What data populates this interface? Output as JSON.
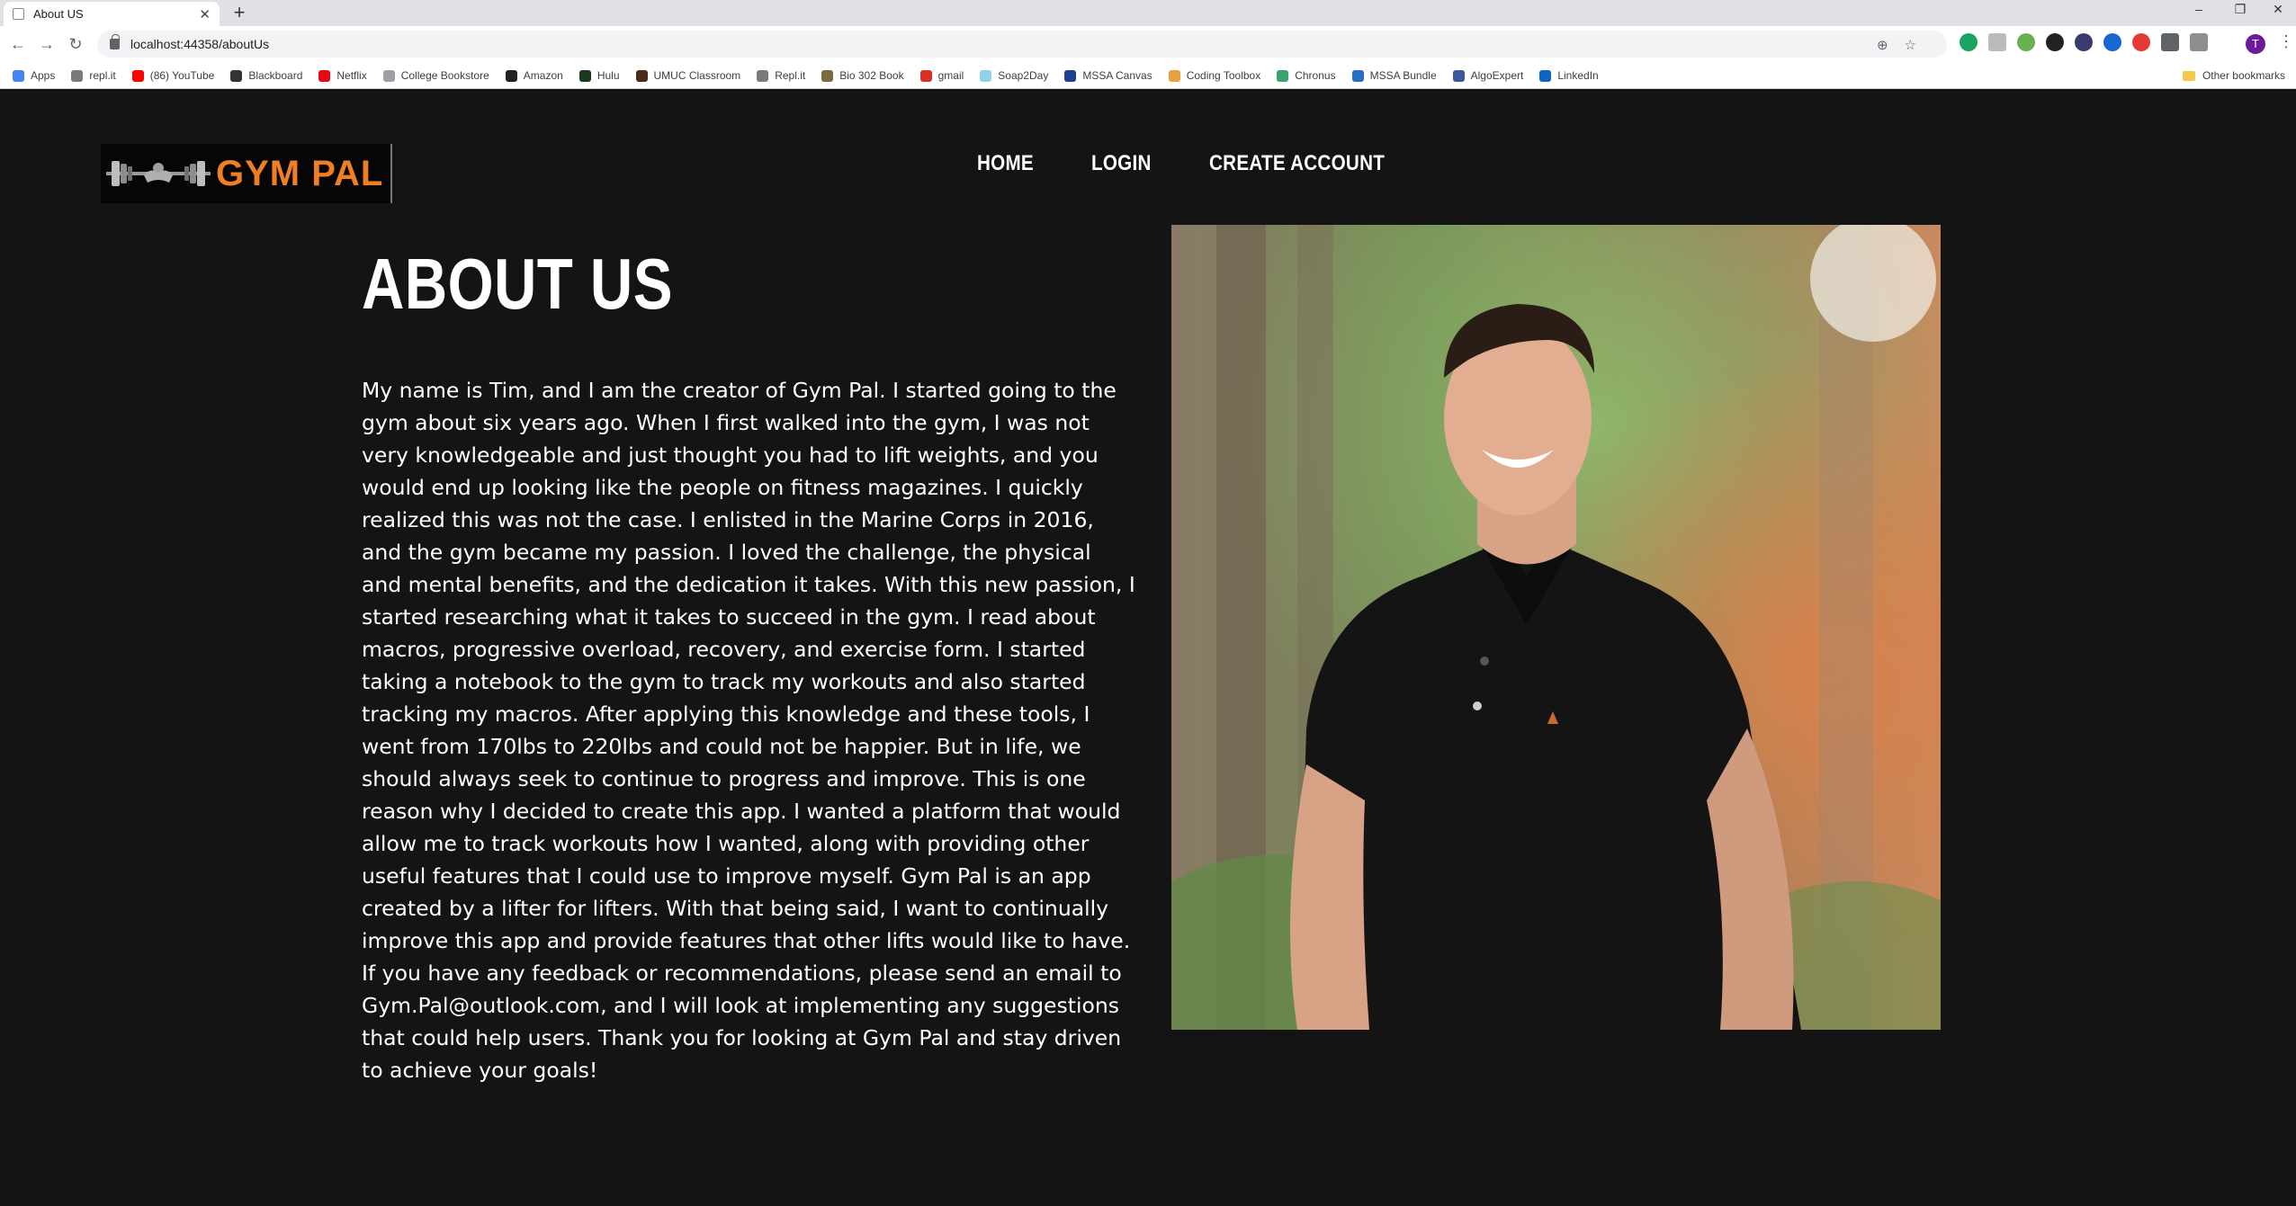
{
  "browser": {
    "tab_title": "About US",
    "tab_close": "✕",
    "new_tab": "+",
    "window_controls": [
      "–",
      "❐",
      "✕"
    ],
    "nav_icons": {
      "back": "←",
      "forward": "→",
      "reload": "↻"
    },
    "url": "localhost:44358/aboutUs",
    "omnibox_icons": [
      "zoom-icon",
      "star-icon"
    ],
    "profile_initial": "T",
    "bookmarks": [
      {
        "label": "Apps",
        "icon": "apps-grid-icon",
        "color": "#4285f4"
      },
      {
        "label": "repl.it",
        "icon": "replit-icon",
        "color": "#7a7a7a"
      },
      {
        "label": "(86) YouTube",
        "icon": "youtube-icon",
        "color": "#ff0000"
      },
      {
        "label": "Blackboard",
        "icon": "blackboard-icon",
        "color": "#333333"
      },
      {
        "label": "Netflix",
        "icon": "netflix-icon",
        "color": "#e50914"
      },
      {
        "label": "College Bookstore",
        "icon": "page-icon",
        "color": "#9aa0a6"
      },
      {
        "label": "Amazon",
        "icon": "amazon-icon",
        "color": "#222222"
      },
      {
        "label": "Hulu",
        "icon": "hulu-icon",
        "color": "#1b3a1b"
      },
      {
        "label": "UMUC Classroom",
        "icon": "umuc-icon",
        "color": "#4a2b1a"
      },
      {
        "label": "Repl.it",
        "icon": "replit-icon",
        "color": "#7a7a7a"
      },
      {
        "label": "Bio 302 Book",
        "icon": "book-icon",
        "color": "#7a6b3a"
      },
      {
        "label": "gmail",
        "icon": "gmail-icon",
        "color": "#d93025"
      },
      {
        "label": "Soap2Day",
        "icon": "soap2day-icon",
        "color": "#8fd3e8"
      },
      {
        "label": "MSSA Canvas",
        "icon": "canvas-icon",
        "color": "#1f3f8f"
      },
      {
        "label": "Coding Toolbox",
        "icon": "toolbox-icon",
        "color": "#e8a040"
      },
      {
        "label": "Chronus",
        "icon": "chronus-icon",
        "color": "#3aa36b"
      },
      {
        "label": "MSSA Bundle",
        "icon": "bundle-icon",
        "color": "#2b6cc4"
      },
      {
        "label": "AlgoExpert",
        "icon": "algoexpert-icon",
        "color": "#3b5998"
      },
      {
        "label": "LinkedIn",
        "icon": "linkedin-icon",
        "color": "#0a66c2"
      }
    ],
    "other_bookmarks": "Other bookmarks"
  },
  "site": {
    "logo_text": "GYM PAL",
    "nav": [
      "HOME",
      "LOGIN",
      "CREATE ACCOUNT"
    ],
    "heading": "ABOUT US",
    "body": "My name is Tim, and I am the creator of Gym Pal. I started going to the gym about six years ago. When I first walked into the gym, I was not very knowledgeable and just thought you had to lift weights, and you would end up looking like the people on fitness magazines. I quickly realized this was not the case. I enlisted in the Marine Corps in 2016, and the gym became my passion. I loved the challenge, the physical and mental benefits, and the dedication it takes. With this new passion, I started researching what it takes to succeed in the gym. I read about macros, progressive overload, recovery, and exercise form. I started taking a notebook to the gym to track my workouts and also started tracking my macros. After applying this knowledge and these tools, I went from 170lbs to 220lbs and could not be happier. But in life, we should always seek to continue to progress and improve. This is one reason why I decided to create this app. I wanted a platform that would allow me to track workouts how I wanted, along with providing other useful features that I could use to improve myself. Gym Pal is an app created by a lifter for lifters. With that being said, I want to continually improve this app and provide features that other lifts would like to have. If you have any feedback or recommendations, please send an email to Gym.Pal@outlook.com, and I will look at implementing any suggestions that could help users. Thank you for looking at Gym Pal and stay driven to achieve your goals!",
    "colors": {
      "background": "#141414",
      "logo_orange": "#f07e22",
      "text": "#ffffff"
    }
  }
}
